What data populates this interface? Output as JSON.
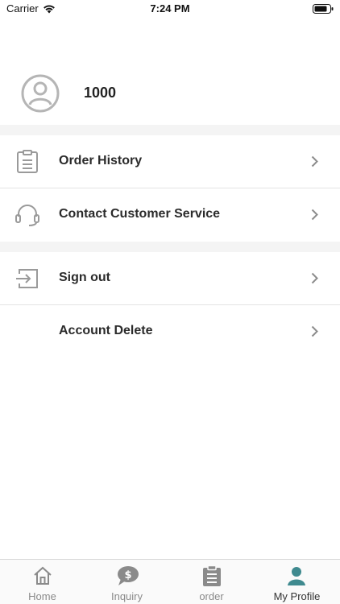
{
  "status_bar": {
    "carrier": "Carrier",
    "time": "7:24 PM"
  },
  "profile": {
    "username": "1000"
  },
  "menu": {
    "order_history": "Order History",
    "contact_service": "Contact Customer Service",
    "sign_out": "Sign out",
    "account_delete": "Account Delete"
  },
  "tabs": [
    {
      "label": "Home",
      "icon": "home-icon"
    },
    {
      "label": "Inquiry",
      "icon": "dollar-chat-icon"
    },
    {
      "label": "order",
      "icon": "clipboard-icon"
    },
    {
      "label": "My Profile",
      "icon": "person-icon"
    }
  ],
  "colors": {
    "accent": "#3f8a8f",
    "tab_inactive": "#8a8a8a",
    "section_gap": "#f4f4f4"
  }
}
